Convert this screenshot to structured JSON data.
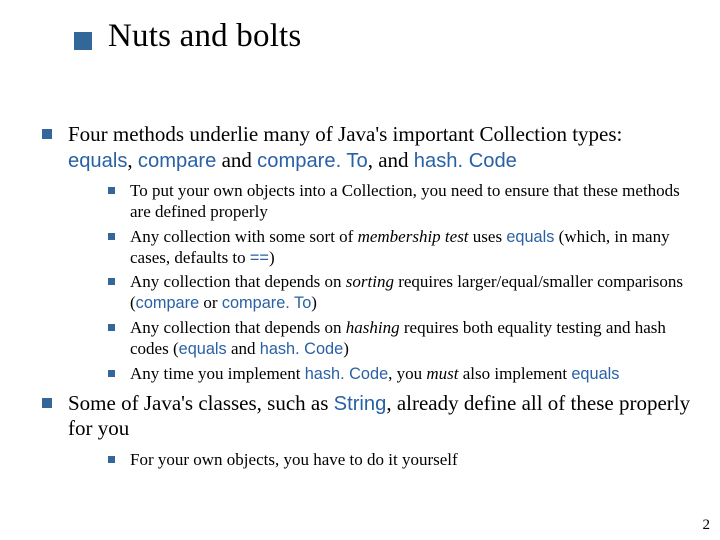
{
  "title": "Nuts and bolts",
  "b1": {
    "pre": "Four methods underlie many of Java's important Collection types: ",
    "c1": "equals",
    "sep1": ", ",
    "c2": "compare",
    "sep2": " and ",
    "c3": "compare. To",
    "sep3": ", and ",
    "c4": "hash. Code"
  },
  "b1s1": "To put your own objects into a Collection, you need to ensure that these methods are defined properly",
  "b1s2": {
    "t1": "Any collection with some sort of ",
    "i1": "membership test",
    "t2": " uses ",
    "c1": "equals",
    "t3": " (which, in many cases, defaults to ",
    "c2": "==",
    "t4": ")"
  },
  "b1s3": {
    "t1": "Any collection that depends on ",
    "i1": "sorting",
    "t2": " requires larger/equal/smaller comparisons (",
    "c1": "compare",
    "t3": " or ",
    "c2": "compare. To",
    "t4": ")"
  },
  "b1s4": {
    "t1": "Any collection that depends on ",
    "i1": "hashing",
    "t2": " requires both equality testing and hash codes (",
    "c1": "equals",
    "t3": " and ",
    "c2": "hash. Code",
    "t4": ")"
  },
  "b1s5": {
    "t1": "Any time you implement ",
    "c1": "hash. Code",
    "t2": ", you ",
    "i1": "must",
    "t3": " also implement ",
    "c2": "equals"
  },
  "b2": {
    "t1": "Some of Java's classes, such as ",
    "c1": "String",
    "t2": ", already define all of these properly for you"
  },
  "b2s1": "For your own objects, you have to do it yourself",
  "page": "2"
}
